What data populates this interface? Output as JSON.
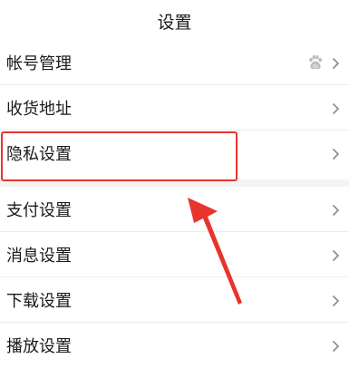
{
  "header": {
    "title": "设置"
  },
  "groups": [
    {
      "items": [
        {
          "label": "帐号管理",
          "trailing_icon": "baidu-paw-icon"
        },
        {
          "label": "收货地址"
        },
        {
          "label": "隐私设置"
        }
      ]
    },
    {
      "items": [
        {
          "label": "支付设置"
        },
        {
          "label": "消息设置"
        },
        {
          "label": "下载设置"
        },
        {
          "label": "播放设置"
        }
      ]
    }
  ],
  "colors": {
    "annotation_red": "#e8342c",
    "chevron": "#8a8a8a",
    "section_gap": "#f4f4f4"
  }
}
